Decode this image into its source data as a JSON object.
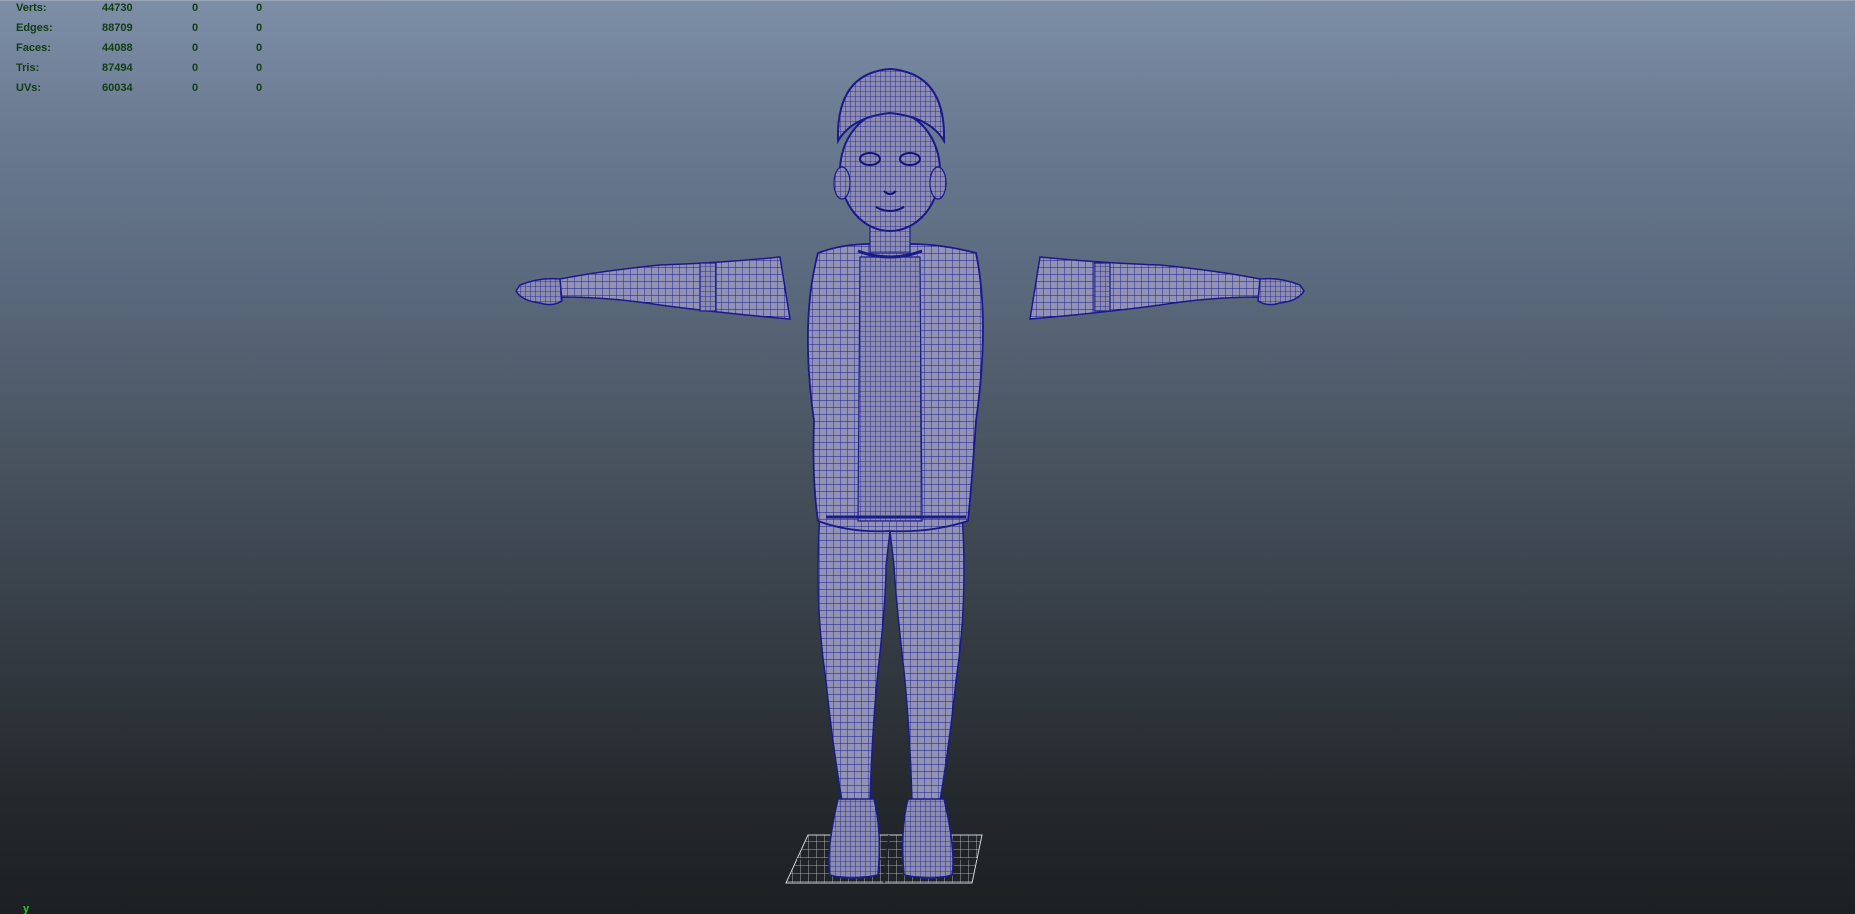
{
  "hud": {
    "rows": [
      {
        "label": "Verts:",
        "v1": "44730",
        "v2": "0",
        "v3": "0"
      },
      {
        "label": "Edges:",
        "v1": "88709",
        "v2": "0",
        "v3": "0"
      },
      {
        "label": "Faces:",
        "v1": "44088",
        "v2": "0",
        "v3": "0"
      },
      {
        "label": "Tris:",
        "v1": "87494",
        "v2": "0",
        "v3": "0"
      },
      {
        "label": "UVs:",
        "v1": "60034",
        "v2": "0",
        "v3": "0"
      }
    ]
  },
  "viewport": {
    "axis_label": "y",
    "wire_color": "#1a1a8c",
    "skin_color": "#8e8fb3",
    "background_top": "#7d8ea7",
    "background_bottom": "#1c2023"
  }
}
